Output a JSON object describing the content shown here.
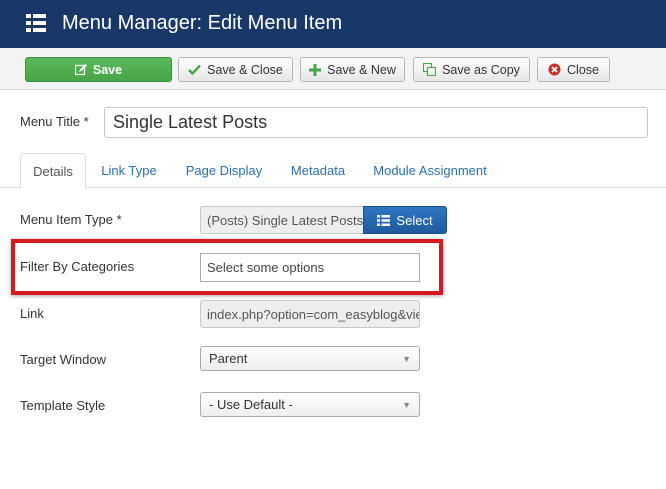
{
  "header": {
    "title": "Menu Manager: Edit Menu Item",
    "icon": "list-icon",
    "bg_color": "#1a3867"
  },
  "toolbar": {
    "save_label": "Save",
    "save_close_label": "Save & Close",
    "save_new_label": "Save & New",
    "save_copy_label": "Save as Copy",
    "close_label": "Close",
    "save_color": "#5cb85c"
  },
  "form": {
    "menu_title_label": "Menu Title *",
    "menu_title_value": "Single Latest Posts"
  },
  "tabs": [
    {
      "label": "Details",
      "active": true
    },
    {
      "label": "Link Type",
      "active": false
    },
    {
      "label": "Page Display",
      "active": false
    },
    {
      "label": "Metadata",
      "active": false
    },
    {
      "label": "Module Assignment",
      "active": false
    }
  ],
  "details": {
    "menu_item_type_label": "Menu Item Type *",
    "menu_item_type_value": "(Posts) Single Latest Posts",
    "select_label": "Select",
    "filter_label": "Filter By Categories",
    "filter_placeholder": "Select some options",
    "link_label": "Link",
    "link_value": "index.php?option=com_easyblog&view=latest",
    "target_window_label": "Target Window",
    "target_window_value": "Parent",
    "template_style_label": "Template Style",
    "template_style_value": "- Use Default -",
    "highlight_color": "#d7191f"
  }
}
